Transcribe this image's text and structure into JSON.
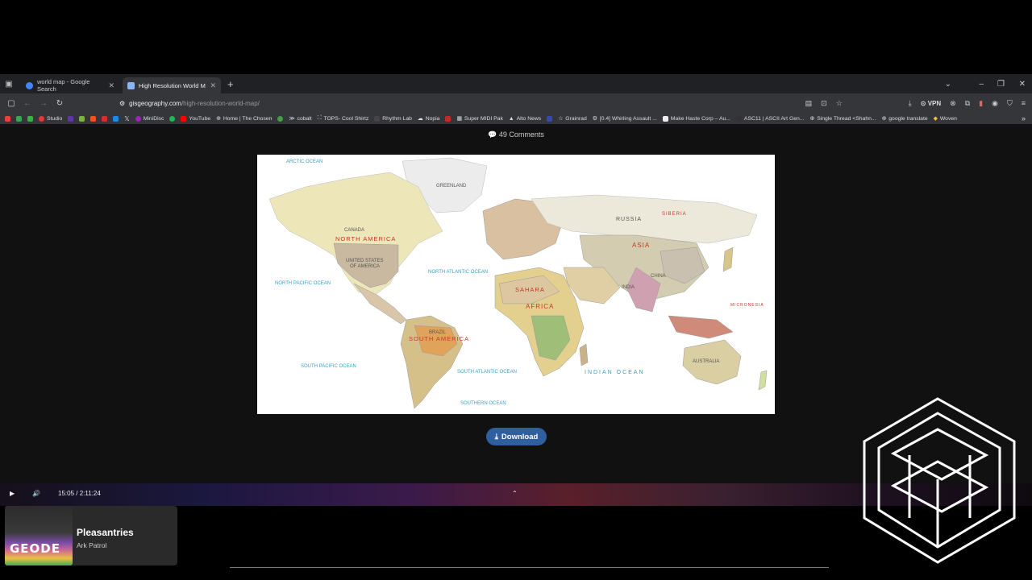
{
  "tabs": [
    {
      "title": "world map - Google Search",
      "active": false,
      "favicon_color": "#4285f4"
    },
    {
      "title": "High Resolution World Map - G",
      "active": true,
      "favicon_color": "#8ab4f8"
    }
  ],
  "address": {
    "domain": "gisgeography.com",
    "path": "/high-resolution-world-map/"
  },
  "vpn_label": "VPN",
  "bookmarks": [
    {
      "label": "Studio",
      "color": "#e53935"
    },
    {
      "label": "MiniDisc",
      "color": "#9c27b0"
    },
    {
      "label": "YouTube",
      "color": "#ff0000"
    },
    {
      "label": "Home | The Chosen",
      "color": "#999999"
    },
    {
      "label": "cobalt",
      "color": "#eeeeee"
    },
    {
      "label": "TOPS- Cool Shirtz",
      "color": "#bbbbbb"
    },
    {
      "label": "Rhythm Lab",
      "color": "#444444"
    },
    {
      "label": "Nopia",
      "color": "#dddddd"
    },
    {
      "label": "Super MIDI Pak",
      "color": "#bbbbbb"
    },
    {
      "label": "Alto News",
      "color": "#eeeeee"
    },
    {
      "label": "Grainrad",
      "color": "#dddddd"
    },
    {
      "label": "[0.4] Whirling Assault ...",
      "color": "#aaaaaa"
    },
    {
      "label": "Make Haste Corp – Au...",
      "color": "#eeeeee"
    },
    {
      "label": "ASC11 | ASCII Art Gen...",
      "color": "#333333"
    },
    {
      "label": "Single Thread <Shahn...",
      "color": "#999999"
    },
    {
      "label": "google translate",
      "color": "#999999"
    },
    {
      "label": "Woven",
      "color": "#f0c040"
    }
  ],
  "page": {
    "comments": "49 Comments",
    "download_label": "Download"
  },
  "map": {
    "labels": {
      "arctic": "ARCTIC OCEAN",
      "greenland": "GREENLAND",
      "canada": "CANADA",
      "north_america": "NORTH AMERICA",
      "usa": "UNITED STATES",
      "usa2": "OF AMERICA",
      "north_pacific": "NORTH PACIFIC OCEAN",
      "north_atlantic": "NORTH ATLANTIC OCEAN",
      "russia": "RUSSIA",
      "siberia": "SIBERIA",
      "asia": "ASIA",
      "china": "CHINA",
      "india": "INDIA",
      "sahara": "SAHARA",
      "africa": "AFRICA",
      "brazil": "BRAZIL",
      "south_america": "SOUTH AMERICA",
      "south_pacific": "SOUTH PACIFIC OCEAN",
      "south_atlantic": "SOUTH ATLANTIC OCEAN",
      "indian_ocean": "INDIAN OCEAN",
      "southern_ocean": "SOUTHERN OCEAN",
      "australia": "AUSTRALIA",
      "micronesia": "MICRONESIA"
    }
  },
  "video": {
    "time": "15:05 / 2:11:24"
  },
  "player": {
    "title": "Pleasantries",
    "artist": "Ark Patrol",
    "art_text": "GEODE"
  }
}
